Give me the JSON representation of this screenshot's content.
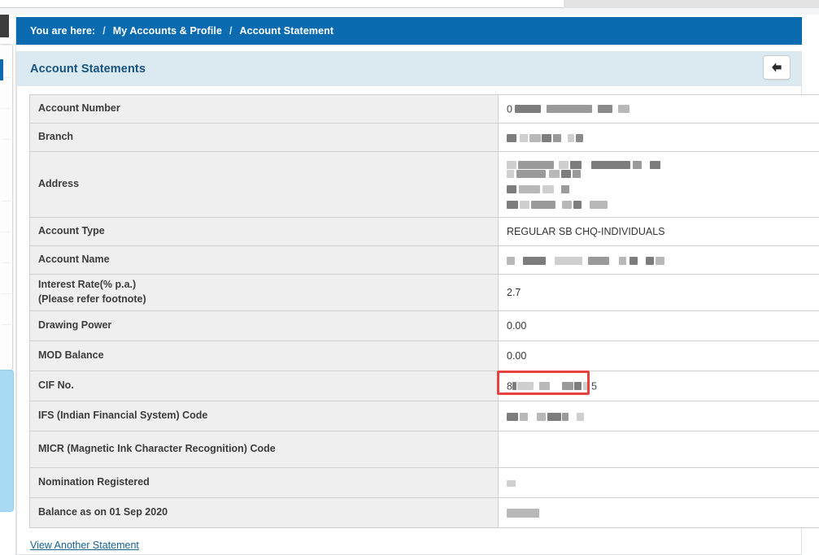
{
  "breadcrumb": {
    "prefix": "You are here:",
    "separator": "/",
    "items": [
      {
        "label": "My Accounts & Profile"
      },
      {
        "label": "Account Statement"
      }
    ]
  },
  "card": {
    "title": "Account Statements",
    "back_button_icon": "arrow-left-icon",
    "back_button_label": "Back"
  },
  "statement": {
    "rows": [
      {
        "label": "Account Number",
        "value": "",
        "value_prefix": "0",
        "redacted": true,
        "highlighted": false
      },
      {
        "label": "Branch",
        "value": "",
        "value_prefix": "",
        "redacted": true,
        "highlighted": false
      },
      {
        "label": "Address",
        "value": "",
        "value_prefix": "",
        "redacted": true,
        "highlighted": false
      },
      {
        "label": "Account Type",
        "value": "REGULAR SB CHQ-INDIVIDUALS",
        "value_prefix": "",
        "redacted": false,
        "highlighted": false
      },
      {
        "label": "Account Name",
        "value": "",
        "value_prefix": "",
        "redacted": true,
        "highlighted": false
      },
      {
        "label": "Interest Rate(% p.a.)\n(Please refer footnote)",
        "value": "2.7",
        "value_prefix": "",
        "redacted": false,
        "highlighted": false
      },
      {
        "label": "Drawing Power",
        "value": "0.00",
        "value_prefix": "",
        "redacted": false,
        "highlighted": false
      },
      {
        "label": "MOD Balance",
        "value": "0.00",
        "value_prefix": "",
        "redacted": false,
        "highlighted": false
      },
      {
        "label": "CIF No.",
        "value": "",
        "value_prefix": "8",
        "value_suffix": "5",
        "redacted": true,
        "highlighted": true
      },
      {
        "label": "IFS (Indian Financial System) Code",
        "value": "",
        "value_prefix": "",
        "redacted": true,
        "highlighted": false
      },
      {
        "label": "MICR (Magnetic Ink Character Recognition) Code",
        "value": "",
        "value_prefix": "",
        "redacted": false,
        "highlighted": false
      },
      {
        "label": "Nomination Registered",
        "value": "",
        "value_prefix": "",
        "redacted": true,
        "highlighted": false
      },
      {
        "label": "Balance as on 01 Sep 2020",
        "value": "",
        "value_prefix": "",
        "redacted": true,
        "highlighted": false
      }
    ]
  },
  "footer": {
    "link_label": "View Another Statement"
  },
  "colors": {
    "breadcrumb_bg": "#0b6bb1",
    "card_header_bg": "#dbe9f1",
    "card_title": "#17537f",
    "label_cell_bg": "#efefef",
    "link": "#15628f",
    "highlight_border": "#e8413f"
  }
}
